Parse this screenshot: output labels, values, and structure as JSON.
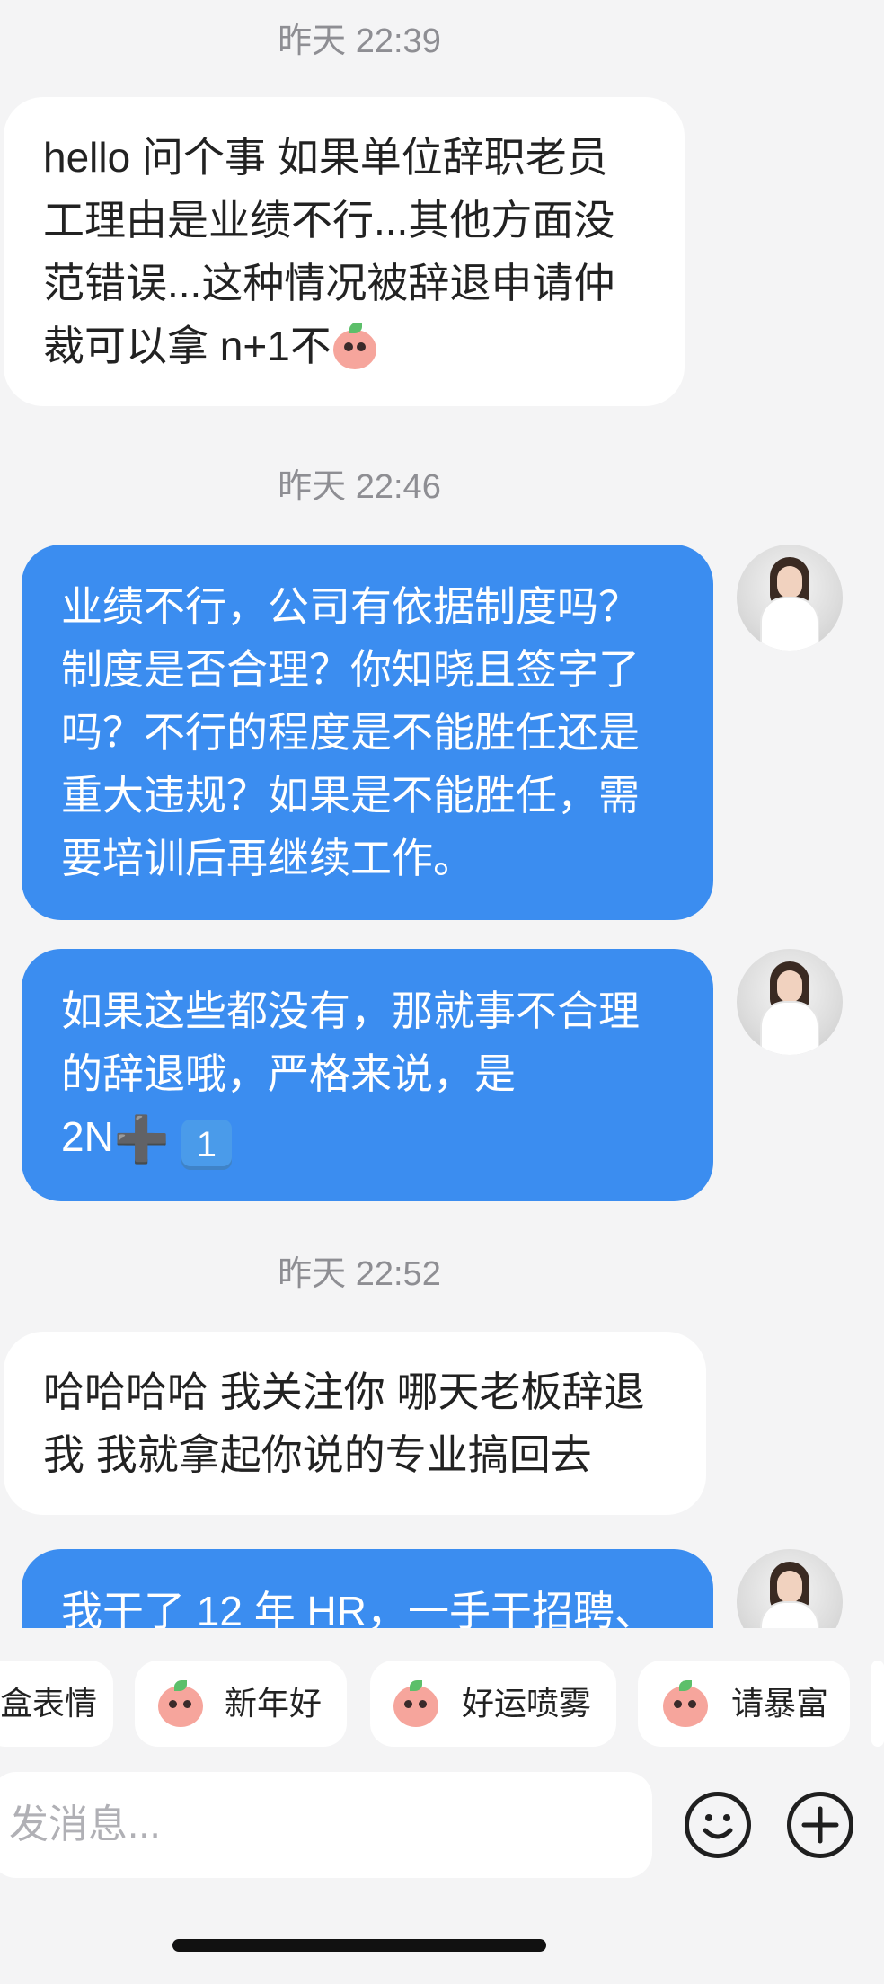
{
  "messages": {
    "ts1": "昨天 22:39",
    "m1": "hello 问个事 如果单位辞职老员工理由是业绩不行...其他方面没范错误...这种情况被辞退申请仲裁可以拿 n+1不",
    "ts2": "昨天 22:46",
    "m2": "业绩不行，公司有依据制度吗？制度是否合理？你知晓且签字了吗？不行的程度是不能胜任还是重大违规？如果是不能胜任，需要培训后再继续工作。",
    "m3_line1": "如果这些都没有，那就事不合理的辞退哦，严格来说，是",
    "m3_prefix": "2N",
    "m3_plus": "➕",
    "m3_keycap": "1",
    "ts3": "昨天 22:52",
    "m4": "哈哈哈哈 我关注你 哪天老板辞退我 我就拿起你说的专业搞回去",
    "m5": "我干了 12 年 HR，一手干招聘、"
  },
  "stickers": [
    {
      "label": "盒表情",
      "icon": "peach-sticker-icon"
    },
    {
      "label": "新年好",
      "icon": "peach-newyear-icon"
    },
    {
      "label": "好运喷雾",
      "icon": "peach-spray-icon"
    },
    {
      "label": "请暴富",
      "icon": "peach-rich-icon"
    }
  ],
  "composer": {
    "placeholder": "发消息...",
    "emoji_icon": "smiley-icon",
    "plus_icon": "plus-circle-icon"
  },
  "colors": {
    "outgoing_bubble": "#3b8df0",
    "incoming_bubble": "#ffffff",
    "background": "#f4f4f5"
  }
}
